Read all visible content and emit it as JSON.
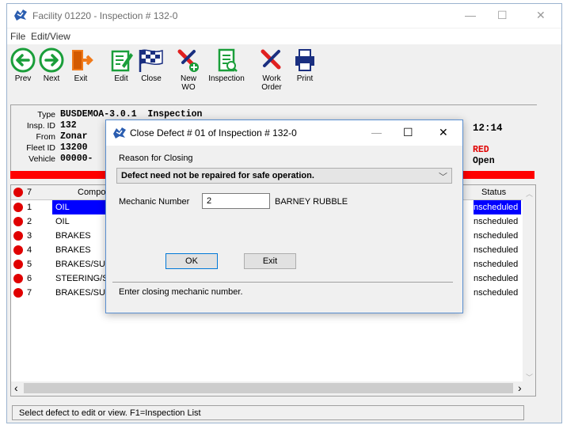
{
  "window": {
    "title": "Facility 01220 - Inspection # 132-0",
    "minimize": "—",
    "maximize": "☐",
    "close": "✕"
  },
  "menu": {
    "file": "File",
    "edit_view": "Edit/View"
  },
  "toolbar": {
    "prev": "Prev",
    "next": "Next",
    "exit": "Exit",
    "edit": "Edit",
    "close": "Close",
    "new_wo_1": "New",
    "new_wo_2": "WO",
    "inspection": "Inspection",
    "work_order_1": "Work",
    "work_order_2": "Order",
    "print": "Print"
  },
  "info": {
    "type_label": "Type",
    "type_value": "BUSDEMOA-3.0.1  Inspection",
    "insp_label": "Insp. ID",
    "insp_value": "132",
    "from_label": "From",
    "from_value": "Zonar",
    "fleet_label": "Fleet ID",
    "fleet_value": "13200",
    "vehicle_label": "Vehicle",
    "vehicle_value": "00000-",
    "time_value": "12:14",
    "status_color_value": "RED",
    "state_value": "Open"
  },
  "grid": {
    "header_count": "7",
    "col_component": "Compone",
    "col_status": "Status",
    "rows": [
      {
        "num": "1",
        "component": "OIL",
        "status": "nscheduled"
      },
      {
        "num": "2",
        "component": "OIL",
        "status": "nscheduled"
      },
      {
        "num": "3",
        "component": "BRAKES",
        "status": "nscheduled"
      },
      {
        "num": "4",
        "component": "BRAKES",
        "status": "nscheduled"
      },
      {
        "num": "5",
        "component": "BRAKES/SUS",
        "status": "nscheduled"
      },
      {
        "num": "6",
        "component": "STEERING/SU",
        "status": "nscheduled"
      },
      {
        "num": "7",
        "component": "BRAKES/SUS",
        "status": "nscheduled"
      }
    ],
    "scroll_left": "‹",
    "scroll_right": "›"
  },
  "status_bar": {
    "text": "Select defect to edit or view. F1=Inspection List"
  },
  "dialog": {
    "title": "Close Defect # 01 of Inspection # 132-0",
    "minimize": "—",
    "maximize": "☐",
    "close": "✕",
    "reason_label": "Reason for Closing",
    "reason_value": "Defect need not be repaired for safe operation.",
    "mechanic_label": "Mechanic Number",
    "mechanic_value": "2",
    "mechanic_name": "BARNEY RUBBLE",
    "ok": "OK",
    "exit": "Exit",
    "status_text": "Enter closing mechanic number."
  },
  "colors": {
    "selection": "#0000ff",
    "alert": "#ff0000",
    "dialog_border": "#5a8fd0"
  }
}
